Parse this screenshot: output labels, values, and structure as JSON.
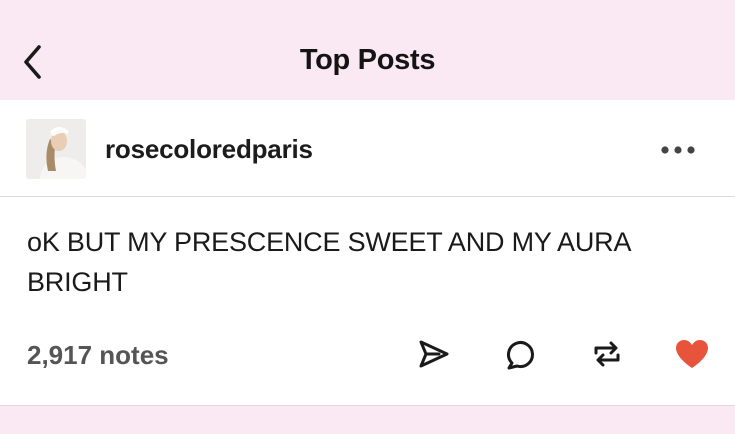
{
  "header": {
    "title": "Top Posts",
    "back_icon": "chevron-left-icon"
  },
  "post": {
    "username": "rosecoloredparis",
    "avatar": "user-avatar-photo",
    "more_icon": "more-horizontal-icon",
    "text": "oK BUT MY PRESCENCE SWEET AND MY AURA BRIGHT",
    "notes": "2,917 notes",
    "actions": [
      "share-icon",
      "reply-icon",
      "reblog-icon",
      "like-icon"
    ]
  },
  "colors": {
    "header_bg": "#fae8f3",
    "card_bg": "#ffffff",
    "like": "#e8533c",
    "text": "#1a1a1a",
    "muted": "#555555"
  }
}
